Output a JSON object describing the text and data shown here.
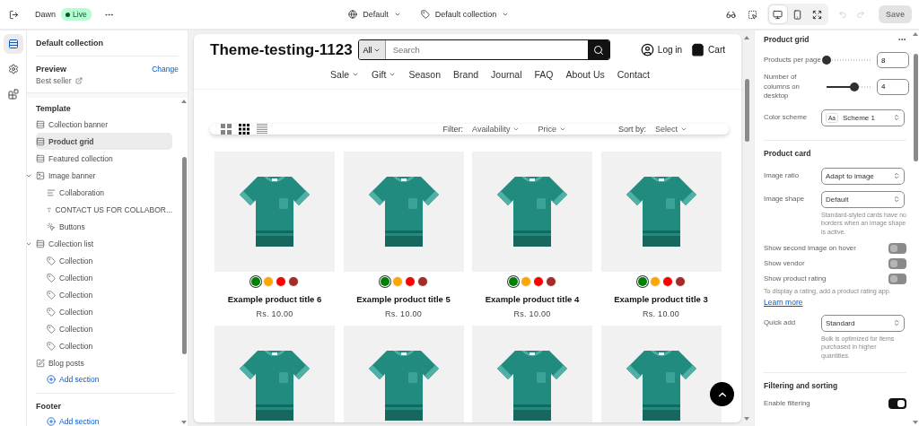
{
  "topbar": {
    "theme": "Dawn",
    "status": "Live",
    "view_selector": "Default",
    "template_selector": "Default collection",
    "devices": [
      {
        "kind": "desktop",
        "selected": true
      },
      {
        "kind": "mobile",
        "selected": false
      },
      {
        "kind": "fullwidth",
        "selected": false
      }
    ],
    "undo_disabled": true,
    "redo_disabled": true,
    "save": {
      "label": "Save",
      "disabled": true
    }
  },
  "rail": [
    {
      "kind": "sections",
      "selected": true
    },
    {
      "kind": "settings",
      "selected": false
    },
    {
      "kind": "apps",
      "selected": false
    }
  ],
  "sidebar": {
    "title": "Default collection",
    "preview": {
      "label": "Preview",
      "action": "Change",
      "value": "Best seller"
    },
    "template": {
      "title": "Template",
      "items": [
        {
          "label": "Collection banner",
          "kind": "section",
          "selected": false
        },
        {
          "label": "Product grid",
          "kind": "section",
          "selected": true
        },
        {
          "label": "Featured collection",
          "kind": "section",
          "selected": false
        },
        {
          "label": "Image banner",
          "kind": "image",
          "selected": false,
          "expanded": true,
          "children": [
            {
              "label": "Collaboration",
              "kind": "lines",
              "selected": false
            },
            {
              "label": "CONTACT US FOR COLLABOR...",
              "kind": "text",
              "selected": false
            },
            {
              "label": "Buttons",
              "kind": "button",
              "selected": false
            }
          ]
        },
        {
          "label": "Collection list",
          "kind": "section",
          "selected": false,
          "expanded": true,
          "children": [
            {
              "label": "Collection",
              "kind": "tag",
              "selected": false
            },
            {
              "label": "Collection",
              "kind": "tag",
              "selected": false
            },
            {
              "label": "Collection",
              "kind": "tag",
              "selected": false
            },
            {
              "label": "Collection",
              "kind": "tag",
              "selected": false
            },
            {
              "label": "Collection",
              "kind": "tag",
              "selected": false
            },
            {
              "label": "Collection",
              "kind": "tag",
              "selected": false
            }
          ]
        },
        {
          "label": "Blog posts",
          "kind": "edit",
          "selected": false
        }
      ],
      "add_section": "Add section"
    },
    "footer": {
      "title": "Footer",
      "add_section": "Add section"
    }
  },
  "store": {
    "logo": "Theme-testing-1123",
    "search": {
      "scope": "All",
      "placeholder": "Search"
    },
    "account": "Log in",
    "cart": "Cart",
    "nav": [
      {
        "label": "Sale",
        "dropdown": true
      },
      {
        "label": "Gift",
        "dropdown": true
      },
      {
        "label": "Season",
        "dropdown": false
      },
      {
        "label": "Brand",
        "dropdown": false
      },
      {
        "label": "Journal",
        "dropdown": false
      },
      {
        "label": "FAQ",
        "dropdown": false
      },
      {
        "label": "About Us",
        "dropdown": false
      },
      {
        "label": "Contact",
        "dropdown": false
      }
    ],
    "filter_bar": {
      "views": [
        {
          "kind": "large-grid",
          "selected": false
        },
        {
          "kind": "small-grid",
          "selected": true
        },
        {
          "kind": "list",
          "selected": false
        }
      ],
      "filter_label": "Filter:",
      "filters": [
        "Availability",
        "Price"
      ],
      "sort_label": "Sort by:",
      "sort_value": "Select"
    },
    "products": [
      {
        "kind": "tshirt",
        "title": "Example product title 6",
        "price": "Rs. 10.00",
        "swatches": [
          {
            "color": "#008000",
            "selected": true
          },
          {
            "color": "#ffa500",
            "selected": false
          },
          {
            "color": "#ff0000",
            "selected": false
          },
          {
            "color": "#a52a2a",
            "selected": false
          }
        ]
      },
      {
        "kind": "tshirt",
        "title": "Example product title 5",
        "price": "Rs. 10.00",
        "swatches": [
          {
            "color": "#008000",
            "selected": true
          },
          {
            "color": "#ffa500",
            "selected": false
          },
          {
            "color": "#ff0000",
            "selected": false
          },
          {
            "color": "#a52a2a",
            "selected": false
          }
        ]
      },
      {
        "kind": "tshirt",
        "title": "Example product title 4",
        "price": "Rs. 10.00",
        "swatches": [
          {
            "color": "#008000",
            "selected": true
          },
          {
            "color": "#ffa500",
            "selected": false
          },
          {
            "color": "#ff0000",
            "selected": false
          },
          {
            "color": "#a52a2a",
            "selected": false
          }
        ]
      },
      {
        "kind": "tshirt",
        "title": "Example product title 3",
        "price": "Rs. 10.00",
        "swatches": [
          {
            "color": "#008000",
            "selected": true
          },
          {
            "color": "#ffa500",
            "selected": false
          },
          {
            "color": "#ff0000",
            "selected": false
          },
          {
            "color": "#a52a2a",
            "selected": false
          }
        ]
      },
      {
        "kind": "tshirt"
      },
      {
        "kind": "tshirt"
      },
      {
        "kind": "tshirt"
      },
      {
        "kind": "tshirt"
      }
    ]
  },
  "settings": [
    {
      "title": "Product grid",
      "fields": [
        {
          "kind": "range",
          "label": "Products per page",
          "level": 0,
          "value": "8"
        },
        {
          "kind": "range",
          "label": "Number of columns on desktop",
          "level": 0.62,
          "value": "4"
        },
        {
          "kind": "scheme",
          "label": "Color scheme",
          "badge": "Aa",
          "value": "Scheme 1"
        }
      ]
    },
    {
      "title": "Product card",
      "fields": [
        {
          "kind": "select",
          "label": "Image ratio",
          "value": "Adapt to image"
        },
        {
          "kind": "select",
          "label": "Image shape",
          "value": "Default",
          "help": "Standard-styled cards have no borders when an image shape is active."
        },
        {
          "kind": "toggle",
          "label": "Show second image on hover",
          "on": false
        },
        {
          "kind": "toggle",
          "label": "Show vendor",
          "on": false
        },
        {
          "kind": "toggle",
          "label": "Show product rating",
          "on": false,
          "note": "To display a rating, add a product rating app.",
          "link": "Learn more"
        },
        {
          "kind": "select",
          "label": "Quick add",
          "value": "Standard",
          "help": "Bulk is optimized for items purchased in higher quantities."
        }
      ]
    },
    {
      "title": "Filtering and sorting",
      "fields": [
        {
          "kind": "toggle",
          "label": "Enable filtering",
          "on": true
        }
      ]
    }
  ]
}
